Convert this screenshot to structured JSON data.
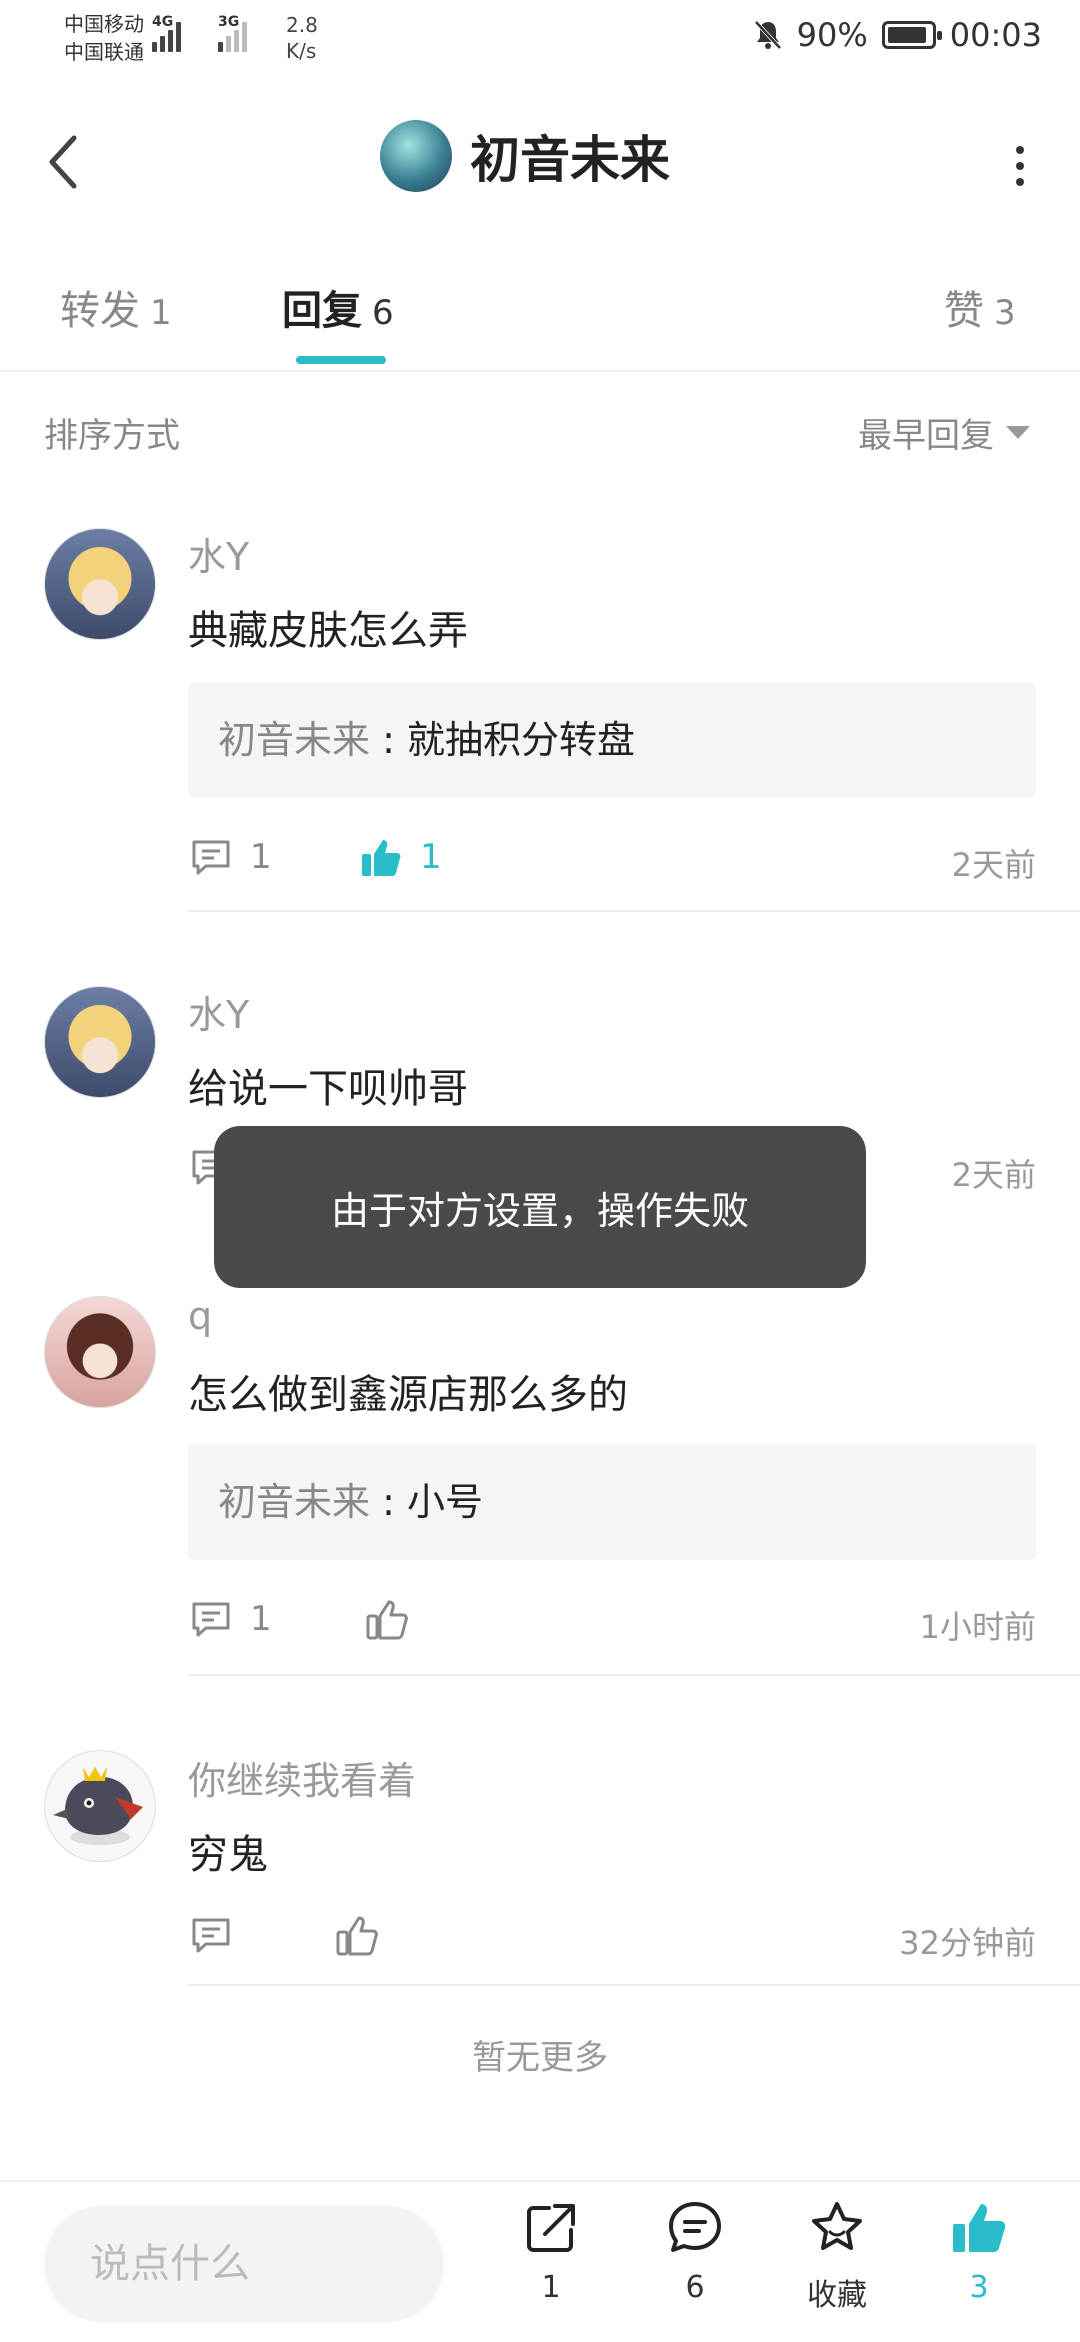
{
  "status_bar": {
    "carrier1": "中国移动",
    "carrier2": "中国联通",
    "net1": "4G",
    "net2": "3G",
    "speed_value": "2.8",
    "speed_unit": "K/s",
    "battery": "90%",
    "time": "00:03"
  },
  "header": {
    "title": "初音未来"
  },
  "tabs": [
    {
      "label": "转发",
      "count": "1"
    },
    {
      "label": "回复",
      "count": "6"
    },
    {
      "label": "赞",
      "count": "3"
    }
  ],
  "sort": {
    "label": "排序方式",
    "value": "最早回复"
  },
  "comments": [
    {
      "name": "水Y",
      "text": "典藏皮肤怎么弄",
      "reply_name": "初音未来",
      "reply_sep": " : ",
      "reply_text": "就抽积分转盘",
      "comment_count": "1",
      "like_count": "1",
      "liked": true,
      "time": "2天前"
    },
    {
      "name": "水Y",
      "text": "给说一下呗帅哥",
      "comment_count": "",
      "like_count": "",
      "liked": false,
      "time": "2天前"
    },
    {
      "name": "q",
      "text": "怎么做到鑫源店那么多的",
      "reply_name": "初音未来",
      "reply_sep": " : ",
      "reply_text": "小号",
      "comment_count": "1",
      "like_count": "",
      "liked": false,
      "time": "1小时前"
    },
    {
      "name": "你继续我看着",
      "text": "穷鬼",
      "comment_count": "",
      "like_count": "",
      "liked": false,
      "time": "32分钟前"
    }
  ],
  "no_more": "暂无更多",
  "toast": "由于对方设置，操作失败",
  "bottom_bar": {
    "input_placeholder": "说点什么",
    "share_count": "1",
    "comment_count": "6",
    "favorite_label": "收藏",
    "like_count": "3"
  },
  "colors": {
    "accent": "#2bbcc9",
    "toast_bg": "#4a4a4a"
  }
}
